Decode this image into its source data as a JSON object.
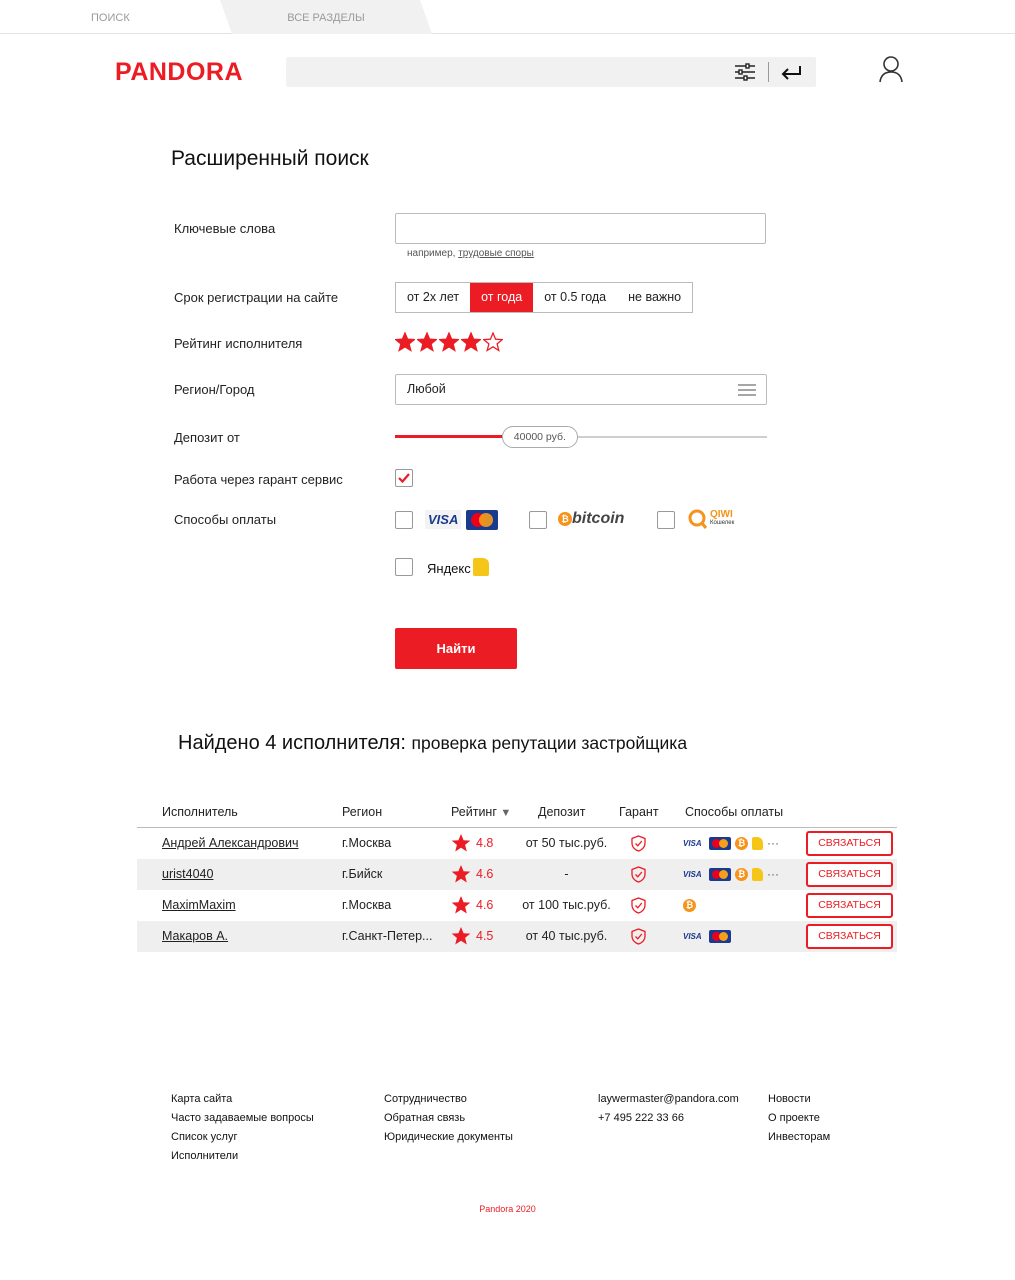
{
  "tabs": {
    "search": "ПОИСК",
    "all_sections": "ВСЕ РАЗДЕЛЫ"
  },
  "header": {
    "logo": "PANDORA",
    "search_value": ""
  },
  "form": {
    "title": "Расширенный поиск",
    "keywords_label": "Ключевые слова",
    "keywords_value": "",
    "hint_prefix": "например, ",
    "hint_link": "трудовые споры",
    "reg_label": "Срок регистрации на сайте",
    "reg_options": [
      "от 2х лет",
      "от года",
      "от 0.5 года",
      "не важно"
    ],
    "reg_selected": "от года",
    "rating_label": "Рейтинг исполнителя",
    "rating_value": 4,
    "rating_max": 5,
    "region_label": "Регион/Город",
    "region_value": "Любой",
    "deposit_label": "Депозит от",
    "deposit_value": "40000 руб.",
    "deposit_fraction": 0.29,
    "guarantee_label": "Работа через гарант сервис",
    "guarantee_checked": true,
    "payment_label": "Способы оплаты",
    "payment_methods": {
      "cards": {
        "visa": "VISA",
        "mastercard": "MasterCard",
        "checked": false
      },
      "bitcoin": {
        "label": "bitcoin",
        "checked": false
      },
      "qiwi": {
        "label": "QIWI",
        "sub": "Кошелек",
        "checked": false
      },
      "yandex": {
        "label": "Яндекс",
        "checked": false
      }
    },
    "submit": "Найти"
  },
  "results": {
    "heading": "Найдено 4 исполнителя:",
    "subheading": "проверка репутации застройщика",
    "columns": [
      "Исполнитель",
      "Регион",
      "Рейтинг",
      "Депозит",
      "Гарант",
      "Способы оплаты"
    ],
    "sort_arrow": "▼",
    "contact_label": "СВЯЗАТЬСЯ",
    "rows": [
      {
        "name": "Андрей Александрович",
        "region": "г.Москва",
        "rating": "4.8",
        "deposit": "от 50 тыс.руб.",
        "payments": [
          "visa",
          "mastercard",
          "bitcoin",
          "yandex",
          "more"
        ]
      },
      {
        "name": "urist4040",
        "region": "г.Бийск",
        "rating": "4.6",
        "deposit": "-",
        "payments": [
          "visa",
          "mastercard",
          "bitcoin",
          "yandex",
          "more"
        ]
      },
      {
        "name": "MaximMaxim",
        "region": "г.Москва",
        "rating": "4.6",
        "deposit": "от 100 тыс.руб.",
        "payments": [
          "bitcoin"
        ]
      },
      {
        "name": "Макаров А.",
        "region": "г.Санкт-Петер...",
        "rating": "4.5",
        "deposit": "от 40 тыс.руб.",
        "payments": [
          "visa",
          "mastercard"
        ]
      }
    ]
  },
  "footer": {
    "col1": [
      "Карта сайта",
      "Часто задаваемые вопросы",
      "Список услуг",
      "Исполнители"
    ],
    "col2": [
      "Сотрудничество",
      "Обратная связь",
      "Юридические документы"
    ],
    "col3": [
      "laywermaster@pandora.com",
      "+7 495 222 33 66"
    ],
    "col4": [
      "Новости",
      "О проекте",
      "Инвесторам"
    ],
    "copyright": "Pandora 2020"
  },
  "colors": {
    "accent": "#ec1c24",
    "grey_bg": "#f1f1f1"
  },
  "icons": [
    "filter-icon",
    "enter-icon",
    "user-icon",
    "star-icon",
    "menu-icon",
    "check-icon",
    "shield-icon"
  ]
}
